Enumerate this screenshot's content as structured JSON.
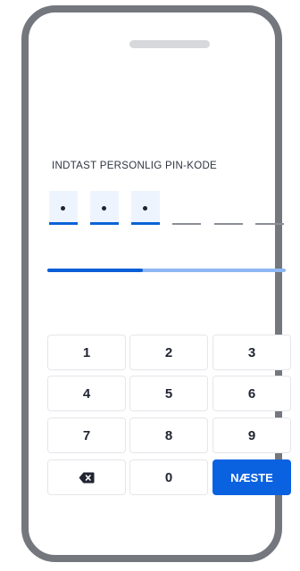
{
  "pin": {
    "prompt": "INDTAST PERSONLIG PIN-KODE",
    "digits_entered": 3,
    "total_digits": 6,
    "mask_char": "•"
  },
  "progress": {
    "value_percent": 40
  },
  "keypad": {
    "keys": [
      "1",
      "2",
      "3",
      "4",
      "5",
      "6",
      "7",
      "8",
      "9"
    ],
    "zero": "0",
    "next_label": "NÆSTE",
    "backspace_icon": "backspace-icon"
  },
  "colors": {
    "accent": "#0b62e0",
    "progress_track": "#8db7f3",
    "frame": "#74777d"
  }
}
